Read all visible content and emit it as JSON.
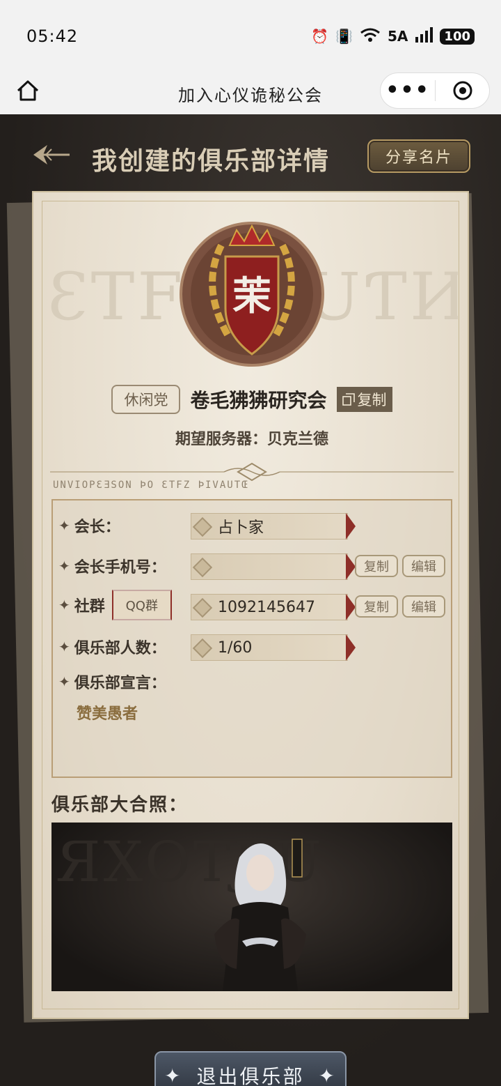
{
  "status_bar": {
    "time": "05:42",
    "network": "5A",
    "battery": "100"
  },
  "miniprogram": {
    "title": "加入心仪诡秘公会"
  },
  "header": {
    "title": "我创建的俱乐部详情",
    "share_label": "分享名片"
  },
  "emblem": {
    "char": "茉"
  },
  "club": {
    "type": "休闲党",
    "name": "卷毛狒狒研究会",
    "copy_label": "复制",
    "server": "期望服务器：贝克兰德"
  },
  "decor": {
    "runes_top": "ƐTFZ ƑUƬИ",
    "rune_line": "UNVIOPƐƎSON ÞO ƐTFZ ÞIVAUTŒ",
    "photo_runes": "ЯXOTƑU"
  },
  "info": {
    "leader_label": "会长：",
    "leader_value": "占卜家",
    "phone_label": "会长手机号：",
    "phone_value": "",
    "community_label": "社群",
    "community_type": "QQ群",
    "community_value": "1092145647",
    "members_label": "俱乐部人数：",
    "members_value": "1/60",
    "manifesto_label": "俱乐部宣言：",
    "manifesto_value": "赞美愚者",
    "copy_label": "复制",
    "edit_label": "编辑"
  },
  "photo": {
    "title": "俱乐部大合照："
  },
  "footer": {
    "exit_label": "退出俱乐部"
  }
}
